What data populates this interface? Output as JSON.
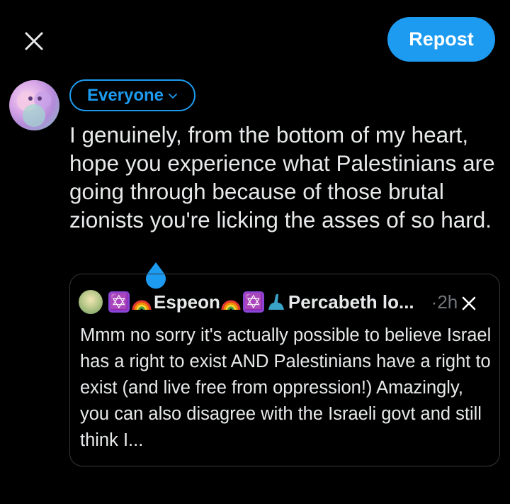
{
  "toolbar": {
    "close_icon": "close-icon",
    "repost_label": "Repost"
  },
  "colors": {
    "background": "#000000",
    "accent": "#1d9bf0",
    "text": "#e7e9ea",
    "muted": "#71767b",
    "card_border": "#333639"
  },
  "composer": {
    "audience_label": "Everyone",
    "audience_icon": "chevron-down-icon",
    "text": "I genuinely, from the bottom of my heart, hope you experience what Palestinians are going through because of those brutal zionists you're licking the asses of so hard."
  },
  "quoted_post": {
    "author_emoji_1": "✡️",
    "author_display_name_a": "Espeon",
    "author_emoji_2": "✡️",
    "author_display_name_b": "Percabeth lo...",
    "timestamp": "·2h",
    "dismiss_icon": "close-icon",
    "body": "Mmm no sorry it's actually possible to believe Israel has a right to exist AND Palestinians have a right to exist (and live free from oppression!) Amazingly, you can also disagree with the Israeli govt and still think I..."
  }
}
